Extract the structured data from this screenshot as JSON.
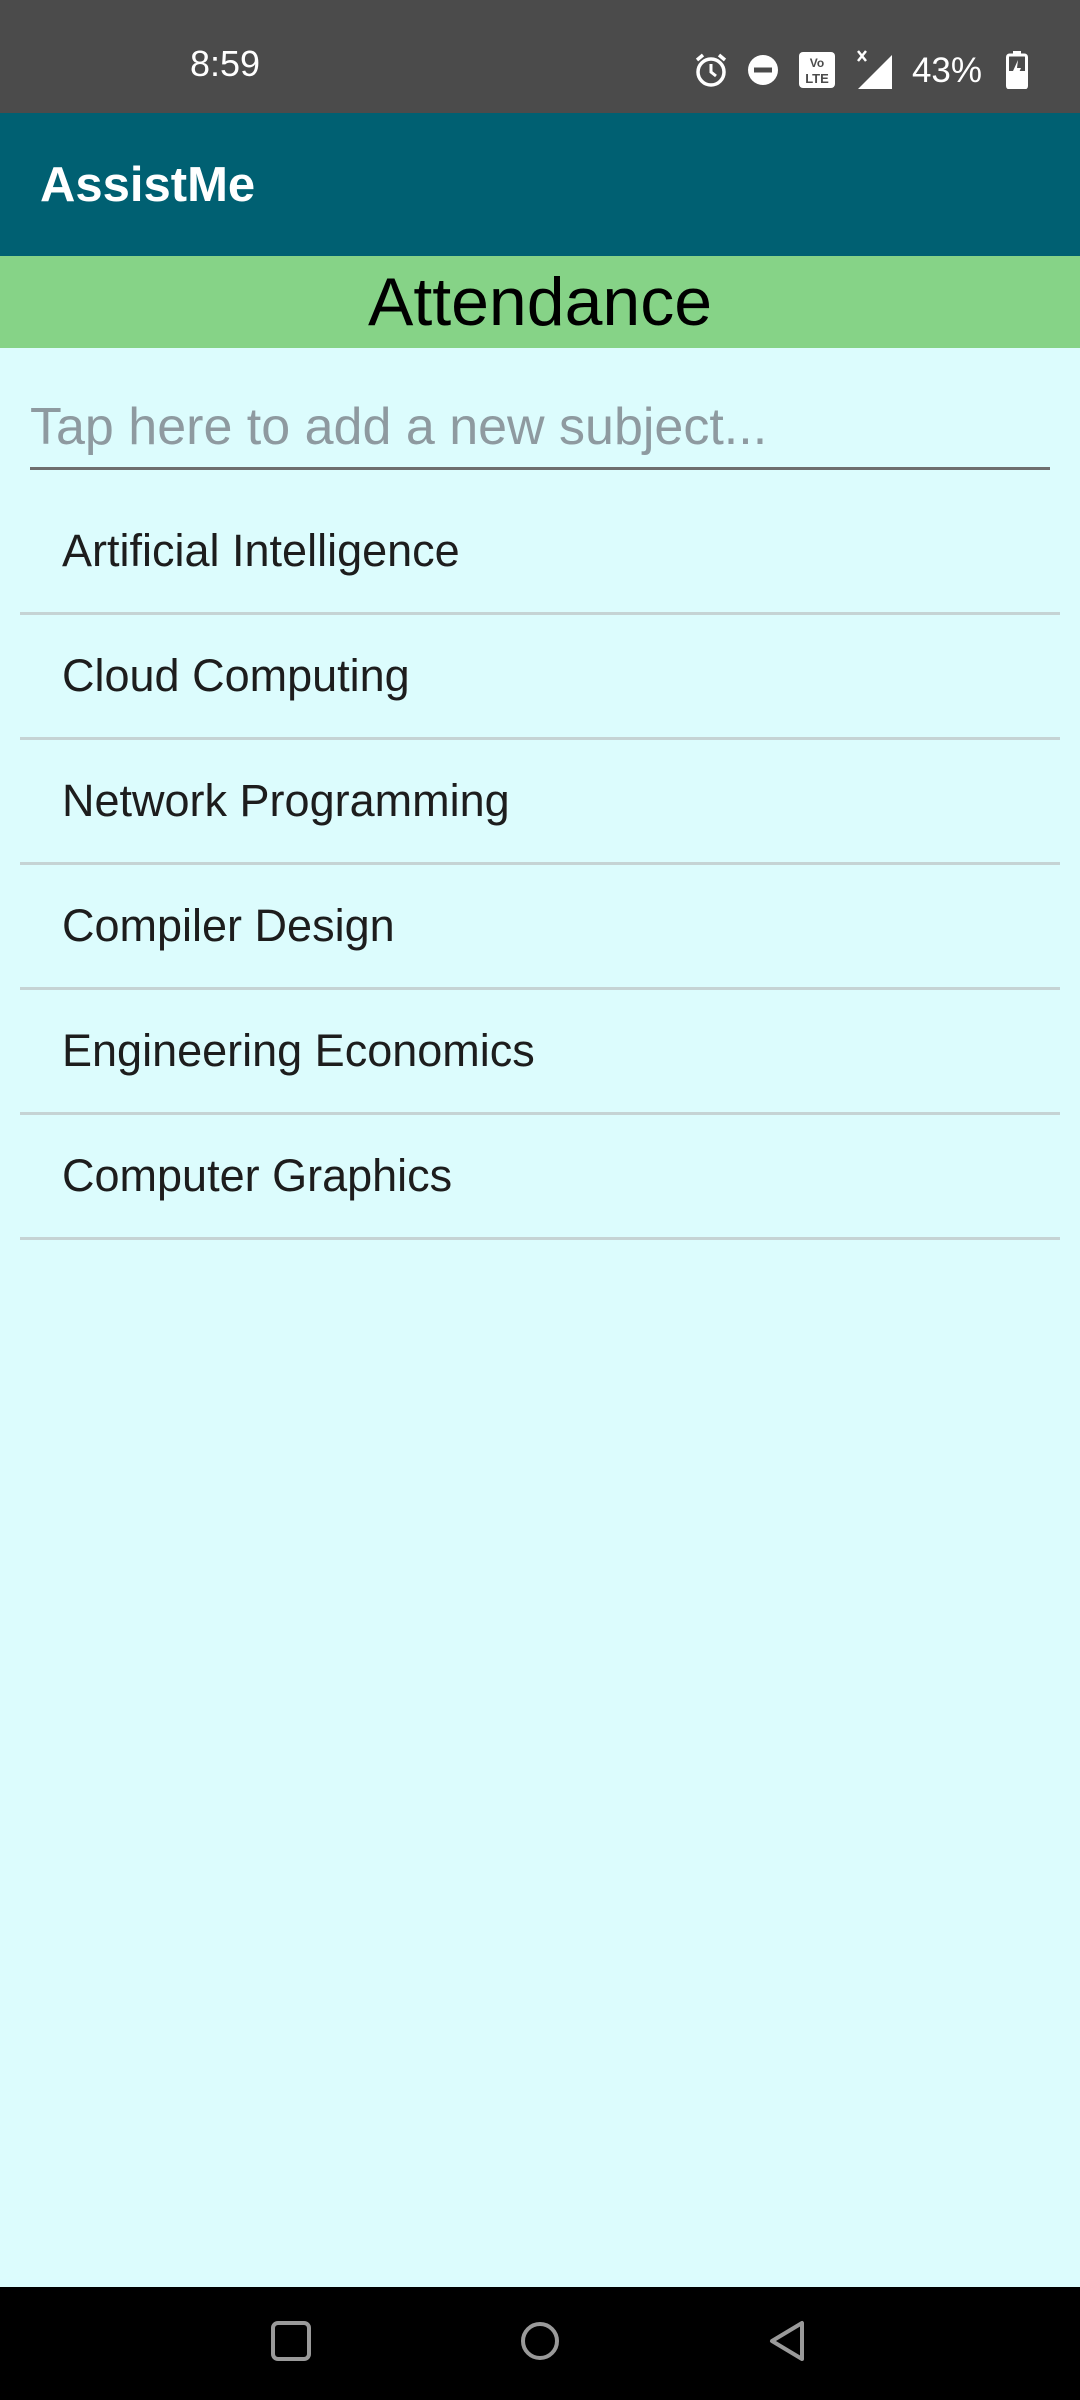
{
  "status_bar": {
    "time": "8:59",
    "battery": "43%",
    "icons": [
      "alarm-icon",
      "do-not-disturb-icon",
      "volte-icon",
      "signal-icon",
      "battery-icon"
    ]
  },
  "app_bar": {
    "title": "AssistMe",
    "color": "#006072"
  },
  "section": {
    "title": "Attendance",
    "color": "#86d387"
  },
  "subject_input": {
    "placeholder": "Tap here to add a new subject...",
    "value": ""
  },
  "subjects": [
    {
      "label": "Artificial Intelligence"
    },
    {
      "label": "Cloud Computing"
    },
    {
      "label": "Network Programming"
    },
    {
      "label": "Compiler Design"
    },
    {
      "label": "Engineering Economics"
    },
    {
      "label": "Computer Graphics"
    }
  ],
  "nav_bar": {
    "icons": [
      "recents-icon",
      "home-icon",
      "back-icon"
    ]
  },
  "colors": {
    "background": "#dcfcfd",
    "status_bar": "#4b4b4b"
  }
}
